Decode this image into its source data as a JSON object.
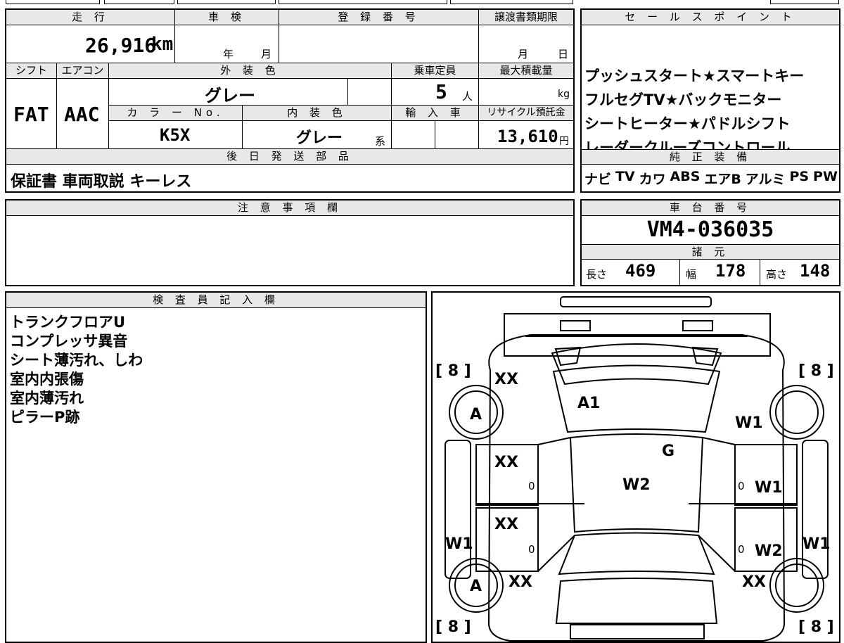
{
  "top_row": {
    "mileage_label": "走 行",
    "mileage_value": "26,916",
    "mileage_unit": "km",
    "inspection_label": "車 検",
    "inspection_year_unit": "年",
    "inspection_month_unit": "月",
    "registration_label": "登 録 番 号",
    "transfer_deadline_label": "譲渡書類期限",
    "transfer_month_unit": "月",
    "transfer_day_unit": "日"
  },
  "specs": {
    "shift_label": "シフト",
    "shift_value": "FAT",
    "aircon_label": "エアコン",
    "aircon_value": "AAC",
    "exterior_color_label": "外 装 色",
    "exterior_color_value": "グレー",
    "capacity_label": "乗車定員",
    "capacity_value": "5",
    "capacity_unit": "人",
    "max_load_label": "最大積載量",
    "max_load_unit": "kg",
    "color_no_label": "カ ラ ー No.",
    "color_no_value": "K5X",
    "interior_color_label": "内 装 色",
    "interior_color_value": "グレー",
    "interior_suffix": "系",
    "import_label": "輸 入 車",
    "recycle_label": "リサイクル預託金",
    "recycle_value": "13,610",
    "recycle_unit": "円"
  },
  "later_parts": {
    "label": "後 日 発 送 部 品",
    "value": "保証書 車両取説 キーレス"
  },
  "sales_points": {
    "label": "セ ー ル ス ポ イ ン ト",
    "lines": [
      "プッシュスタート★スマートキー",
      "フルセグTV★バックモニター",
      "シートヒーター★パドルシフト",
      "レーダークルーズコントロール"
    ]
  },
  "genuine_equipment": {
    "label": "純 正 装 備",
    "items": [
      "ナビ",
      "TV",
      "カワ",
      "ABS",
      "エアB",
      "アルミ",
      "PS",
      "PW"
    ]
  },
  "notes": {
    "label": "注 意 事 項 欄",
    "value": ""
  },
  "chassis": {
    "label": "車 台 番 号",
    "value": "VM4-036035",
    "dims_label": "諸 元",
    "length_label": "長さ",
    "length_value": "469",
    "width_label": "幅",
    "width_value": "178",
    "height_label": "高さ",
    "height_value": "148"
  },
  "inspector": {
    "label": "検 査 員 記 入 欄",
    "lines": [
      "トランクフロアU",
      "コンプレッサ異音",
      "シート薄汚れ、しわ",
      "室内内張傷",
      "室内薄汚れ",
      "ピラーP跡"
    ]
  },
  "diagram": {
    "tire_depth": "[ 8 ]",
    "tire_depth_bracketed": [
      "[ 8 ]",
      "[ 8 ]",
      "[ 8 ]",
      "[ 8 ]"
    ],
    "marks": {
      "front_left_fender": "XX",
      "front_left_wheel": "A",
      "hood": "A1",
      "front_right_fender": "W1",
      "windshield": "G",
      "front_left_door": "XX",
      "front_left_door_zero": "0",
      "roof": "W2",
      "front_right_door_zero": "0",
      "front_right_door": "W1",
      "rear_left_door": "XX",
      "rear_left_door_zero": "0",
      "left_step": "W1",
      "rear_right_door_zero": "0",
      "rear_right_door": "W2",
      "right_step": "W1",
      "rear_left_wheel": "A",
      "rear_left_quarter": "XX",
      "rear_right_quarter": "XX"
    }
  }
}
